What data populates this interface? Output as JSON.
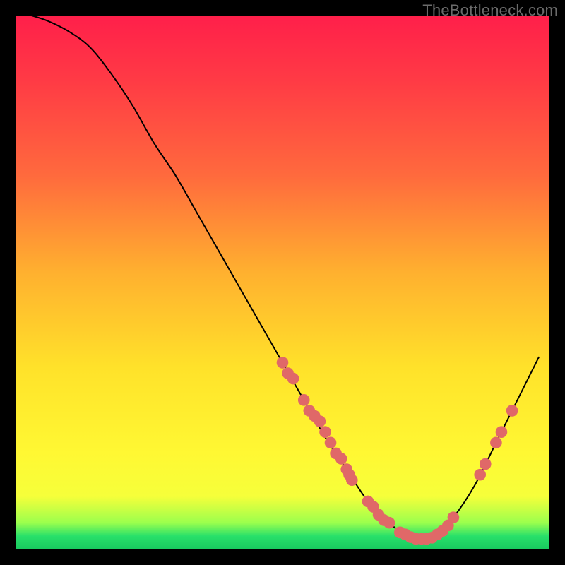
{
  "watermark": "TheBottleneck.com",
  "chart_data": {
    "type": "line",
    "title": "",
    "xlabel": "",
    "ylabel": "",
    "xlim": [
      0,
      100
    ],
    "ylim": [
      0,
      100
    ],
    "grid": false,
    "legend": false,
    "series": [
      {
        "name": "curve",
        "x": [
          3,
          6,
          10,
          14,
          18,
          22,
          26,
          30,
          34,
          38,
          42,
          46,
          50,
          54,
          58,
          62,
          66,
          70,
          74,
          78,
          82,
          86,
          90,
          94,
          98
        ],
        "y": [
          100,
          99,
          97,
          94,
          89,
          83,
          76,
          70,
          63,
          56,
          49,
          42,
          35,
          28,
          21,
          15,
          9,
          5,
          2,
          2,
          6,
          12,
          20,
          28,
          36
        ]
      }
    ],
    "markers": {
      "name": "data-points",
      "color": "#e06868",
      "radius_pct": 1.1,
      "points": [
        {
          "x": 50,
          "y": 35
        },
        {
          "x": 51,
          "y": 33
        },
        {
          "x": 52,
          "y": 32
        },
        {
          "x": 54,
          "y": 28
        },
        {
          "x": 55,
          "y": 26
        },
        {
          "x": 56,
          "y": 25
        },
        {
          "x": 57,
          "y": 24
        },
        {
          "x": 58,
          "y": 22
        },
        {
          "x": 59,
          "y": 20
        },
        {
          "x": 60,
          "y": 18
        },
        {
          "x": 61,
          "y": 17
        },
        {
          "x": 62,
          "y": 15
        },
        {
          "x": 62.5,
          "y": 14
        },
        {
          "x": 63,
          "y": 13
        },
        {
          "x": 66,
          "y": 9
        },
        {
          "x": 67,
          "y": 8
        },
        {
          "x": 68,
          "y": 6.5
        },
        {
          "x": 69,
          "y": 5.5
        },
        {
          "x": 70,
          "y": 5
        },
        {
          "x": 72,
          "y": 3.2
        },
        {
          "x": 73,
          "y": 2.8
        },
        {
          "x": 74,
          "y": 2.3
        },
        {
          "x": 75,
          "y": 2
        },
        {
          "x": 76,
          "y": 2
        },
        {
          "x": 77,
          "y": 2
        },
        {
          "x": 78,
          "y": 2.2
        },
        {
          "x": 79,
          "y": 2.8
        },
        {
          "x": 80,
          "y": 3.5
        },
        {
          "x": 81,
          "y": 4.5
        },
        {
          "x": 82,
          "y": 6
        },
        {
          "x": 87,
          "y": 14
        },
        {
          "x": 88,
          "y": 16
        },
        {
          "x": 90,
          "y": 20
        },
        {
          "x": 91,
          "y": 22
        },
        {
          "x": 93,
          "y": 26
        }
      ]
    }
  }
}
